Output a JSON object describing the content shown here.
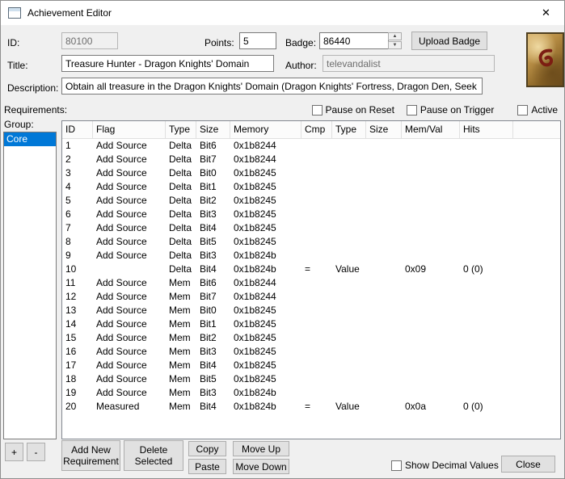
{
  "window": {
    "title": "Achievement Editor",
    "close_glyph": "✕"
  },
  "fields": {
    "id_label": "ID:",
    "id_value": "80100",
    "points_label": "Points:",
    "points_value": "5",
    "badge_label": "Badge:",
    "badge_value": "86440",
    "upload_badge_label": "Upload Badge",
    "title_label": "Title:",
    "title_value": "Treasure Hunter - Dragon Knights' Domain",
    "author_label": "Author:",
    "author_value": "televandalist",
    "description_label": "Description:",
    "description_value": "Obtain all treasure in the Dragon Knights' Domain (Dragon Knights' Fortress, Dragon Den, Seek Valley)"
  },
  "requirements": {
    "label": "Requirements:",
    "pause_on_reset": "Pause on Reset",
    "pause_on_trigger": "Pause on Trigger",
    "active": "Active"
  },
  "group": {
    "label": "Group:",
    "items": [
      "Core"
    ],
    "selected_index": 0
  },
  "table": {
    "headers": [
      "ID",
      "Flag",
      "Type",
      "Size",
      "Memory",
      "Cmp",
      "Type",
      "Size",
      "Mem/Val",
      "Hits"
    ],
    "rows": [
      [
        "1",
        "Add Source",
        "Delta",
        "Bit6",
        "0x1b8244",
        "",
        "",
        "",
        "",
        ""
      ],
      [
        "2",
        "Add Source",
        "Delta",
        "Bit7",
        "0x1b8244",
        "",
        "",
        "",
        "",
        ""
      ],
      [
        "3",
        "Add Source",
        "Delta",
        "Bit0",
        "0x1b8245",
        "",
        "",
        "",
        "",
        ""
      ],
      [
        "4",
        "Add Source",
        "Delta",
        "Bit1",
        "0x1b8245",
        "",
        "",
        "",
        "",
        ""
      ],
      [
        "5",
        "Add Source",
        "Delta",
        "Bit2",
        "0x1b8245",
        "",
        "",
        "",
        "",
        ""
      ],
      [
        "6",
        "Add Source",
        "Delta",
        "Bit3",
        "0x1b8245",
        "",
        "",
        "",
        "",
        ""
      ],
      [
        "7",
        "Add Source",
        "Delta",
        "Bit4",
        "0x1b8245",
        "",
        "",
        "",
        "",
        ""
      ],
      [
        "8",
        "Add Source",
        "Delta",
        "Bit5",
        "0x1b8245",
        "",
        "",
        "",
        "",
        ""
      ],
      [
        "9",
        "Add Source",
        "Delta",
        "Bit3",
        "0x1b824b",
        "",
        "",
        "",
        "",
        ""
      ],
      [
        "10",
        "",
        "Delta",
        "Bit4",
        "0x1b824b",
        "=",
        "Value",
        "",
        "0x09",
        "0 (0)"
      ],
      [
        "11",
        "Add Source",
        "Mem",
        "Bit6",
        "0x1b8244",
        "",
        "",
        "",
        "",
        ""
      ],
      [
        "12",
        "Add Source",
        "Mem",
        "Bit7",
        "0x1b8244",
        "",
        "",
        "",
        "",
        ""
      ],
      [
        "13",
        "Add Source",
        "Mem",
        "Bit0",
        "0x1b8245",
        "",
        "",
        "",
        "",
        ""
      ],
      [
        "14",
        "Add Source",
        "Mem",
        "Bit1",
        "0x1b8245",
        "",
        "",
        "",
        "",
        ""
      ],
      [
        "15",
        "Add Source",
        "Mem",
        "Bit2",
        "0x1b8245",
        "",
        "",
        "",
        "",
        ""
      ],
      [
        "16",
        "Add Source",
        "Mem",
        "Bit3",
        "0x1b8245",
        "",
        "",
        "",
        "",
        ""
      ],
      [
        "17",
        "Add Source",
        "Mem",
        "Bit4",
        "0x1b8245",
        "",
        "",
        "",
        "",
        ""
      ],
      [
        "18",
        "Add Source",
        "Mem",
        "Bit5",
        "0x1b8245",
        "",
        "",
        "",
        "",
        ""
      ],
      [
        "19",
        "Add Source",
        "Mem",
        "Bit3",
        "0x1b824b",
        "",
        "",
        "",
        "",
        ""
      ],
      [
        "20",
        "Measured",
        "Mem",
        "Bit4",
        "0x1b824b",
        "=",
        "Value",
        "",
        "0x0a",
        "0 (0)"
      ]
    ]
  },
  "footer": {
    "plus_label": "+",
    "minus_label": "-",
    "add_new_label": "Add New Requirement",
    "delete_selected_label": "Delete Selected",
    "copy_label": "Copy",
    "paste_label": "Paste",
    "move_up_label": "Move Up",
    "move_down_label": "Move Down",
    "show_decimal_label": "Show Decimal Values",
    "close_label": "Close"
  },
  "spinner": {
    "up_glyph": "▲",
    "down_glyph": "▼"
  }
}
